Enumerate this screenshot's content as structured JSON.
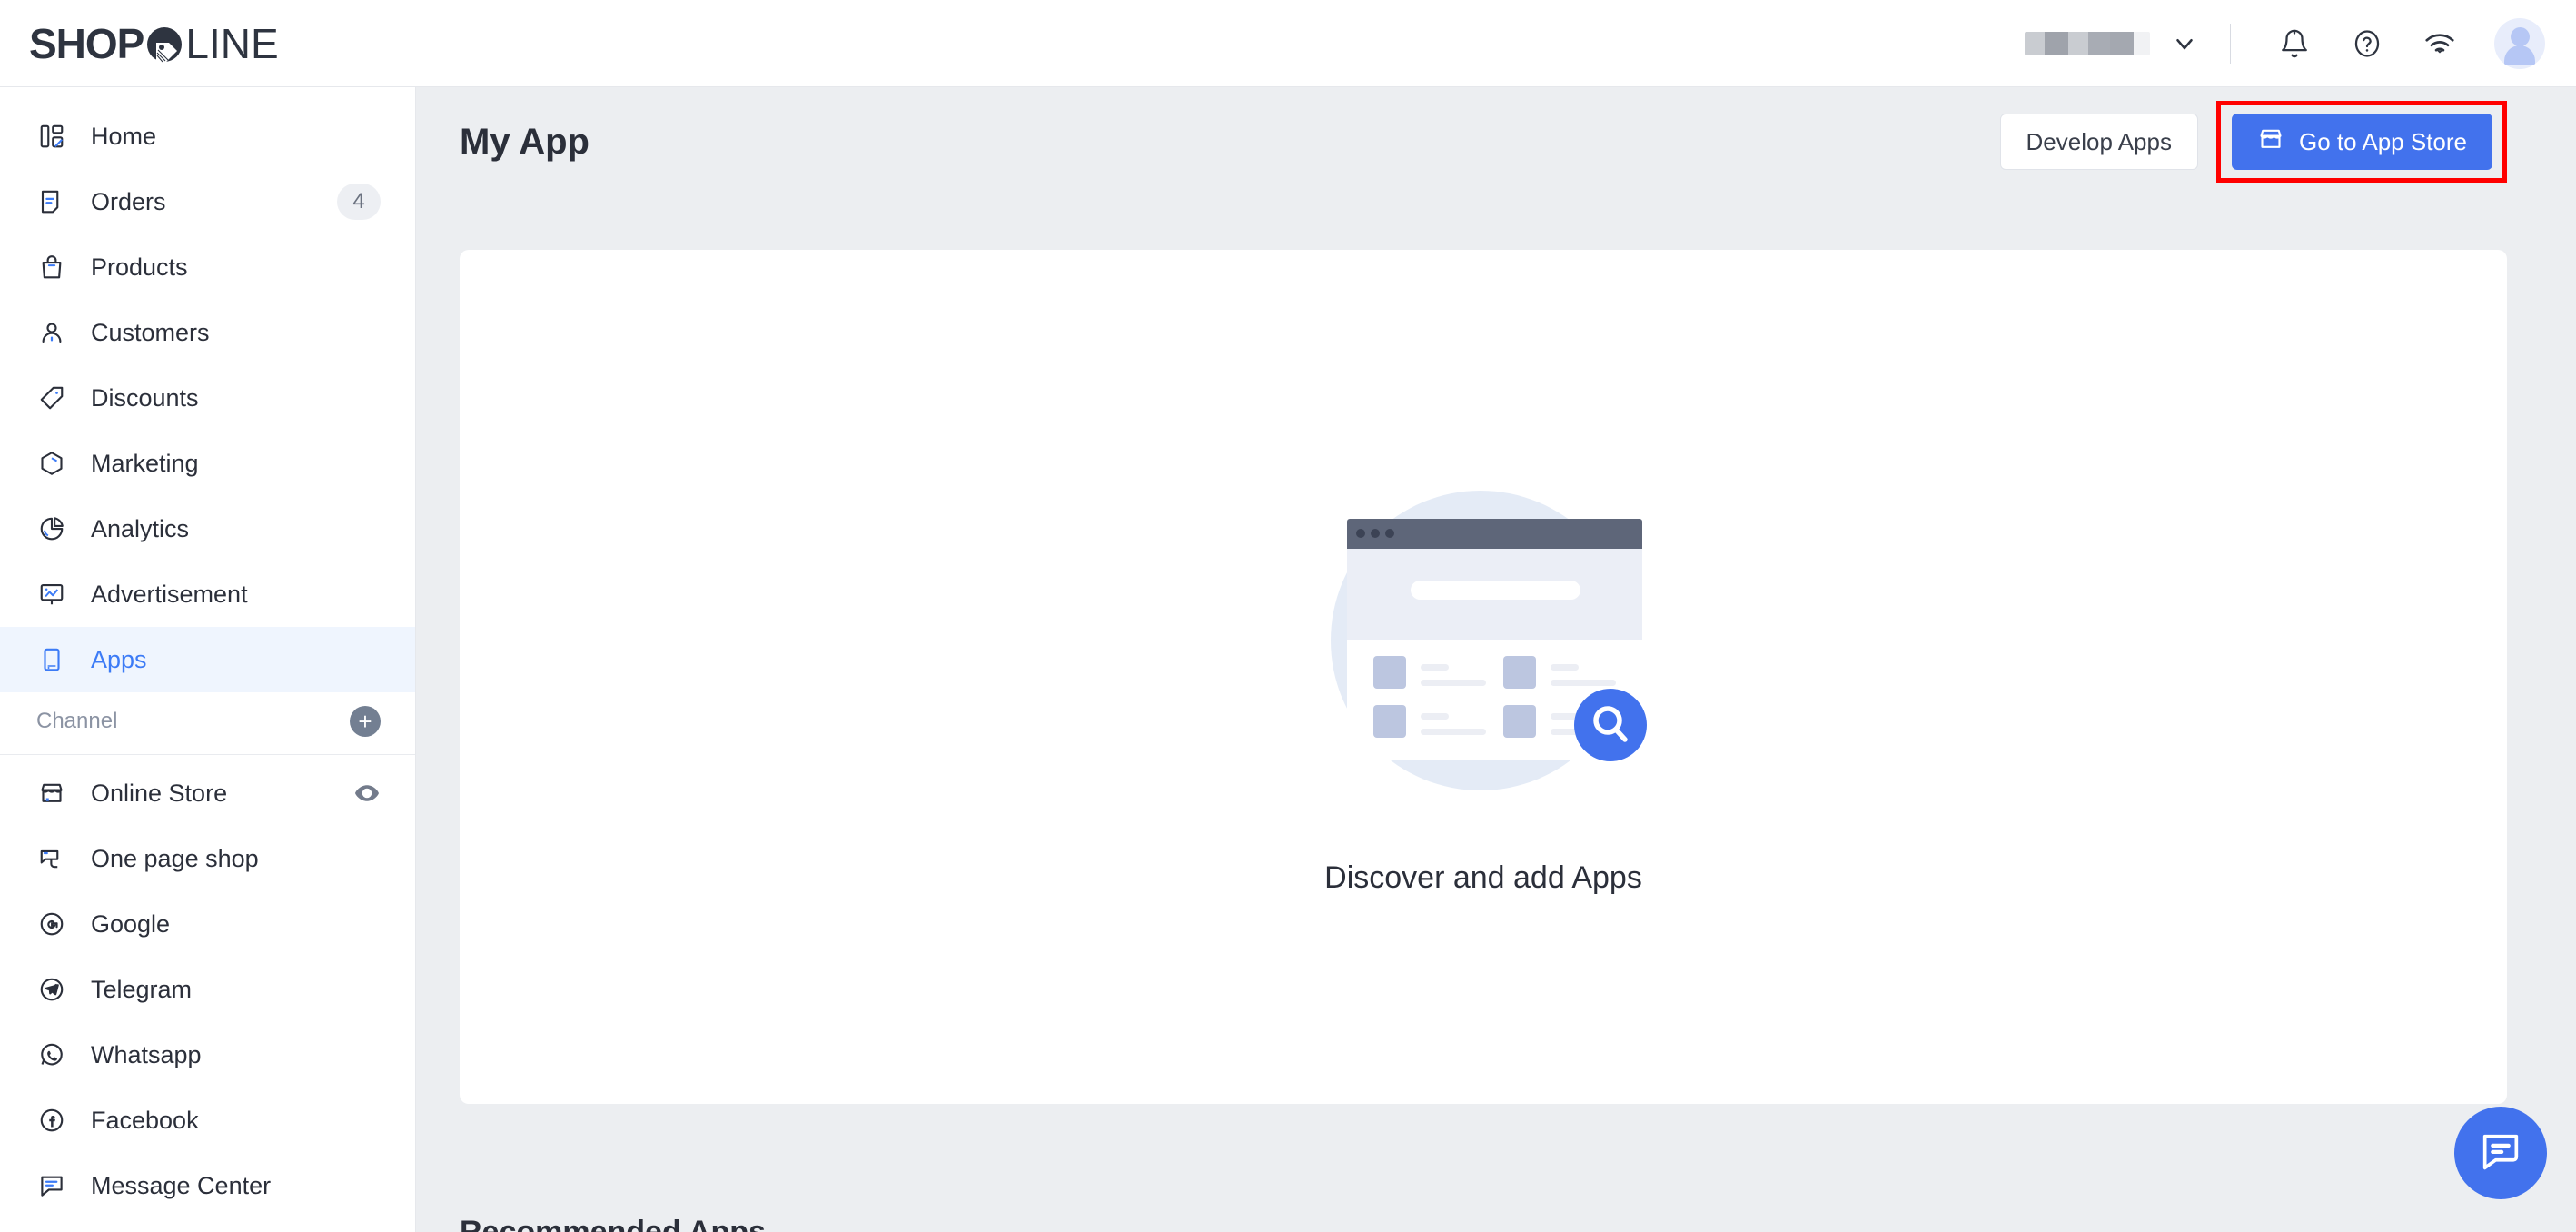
{
  "brand": {
    "logo_shop": "SHOP",
    "logo_line": "LINE",
    "accent_blue": "#4272ed",
    "active_nav_bg": "#eff5fe",
    "page_bg": "#eceef1",
    "annotation_red": "#ff0000"
  },
  "topbar": {
    "store_name_redacted": "",
    "chevron_icon": "chevron-down-icon",
    "notifications_icon": "bell-icon",
    "help_icon": "question-mark-icon",
    "network_icon": "wifi-icon",
    "avatar_icon": "user-avatar-icon"
  },
  "sidebar": {
    "items": [
      {
        "label": "Home",
        "icon": "dashboard-icon",
        "badge": "",
        "active": false
      },
      {
        "label": "Orders",
        "icon": "order-doc-icon",
        "badge": "4",
        "active": false
      },
      {
        "label": "Products",
        "icon": "shopping-bag-icon",
        "badge": "",
        "active": false
      },
      {
        "label": "Customers",
        "icon": "person-icon",
        "badge": "",
        "active": false
      },
      {
        "label": "Discounts",
        "icon": "tag-icon",
        "badge": "",
        "active": false
      },
      {
        "label": "Marketing",
        "icon": "cube-icon",
        "badge": "",
        "active": false
      },
      {
        "label": "Analytics",
        "icon": "pie-chart-icon",
        "badge": "",
        "active": false
      },
      {
        "label": "Advertisement",
        "icon": "ad-board-icon",
        "badge": "",
        "active": false
      },
      {
        "label": "Apps",
        "icon": "mobile-app-icon",
        "badge": "",
        "active": true
      }
    ],
    "channel_section": {
      "label": "Channel",
      "add_icon": "plus-circle-icon",
      "add_label": "+"
    },
    "channels": [
      {
        "label": "Online Store",
        "icon": "storefront-icon",
        "trailing_icon": "eye-icon"
      },
      {
        "label": "One page shop",
        "icon": "one-page-icon",
        "trailing_icon": ""
      },
      {
        "label": "Google",
        "icon": "google-icon",
        "trailing_icon": ""
      },
      {
        "label": "Telegram",
        "icon": "telegram-icon",
        "trailing_icon": ""
      },
      {
        "label": "Whatsapp",
        "icon": "whatsapp-icon",
        "trailing_icon": ""
      },
      {
        "label": "Facebook",
        "icon": "facebook-icon",
        "trailing_icon": ""
      },
      {
        "label": "Message Center",
        "icon": "message-icon",
        "trailing_icon": ""
      }
    ]
  },
  "main": {
    "page_title": "My App",
    "develop_apps_label": "Develop Apps",
    "go_to_app_store_label": "Go to App Store",
    "go_to_app_store_icon": "storefront-icon",
    "empty_state_text": "Discover and add Apps",
    "empty_state_illustration": "browser-search-illustration",
    "next_section_title": "Recommended Apps"
  },
  "fab": {
    "icon": "chat-bubble-icon",
    "label": ""
  }
}
